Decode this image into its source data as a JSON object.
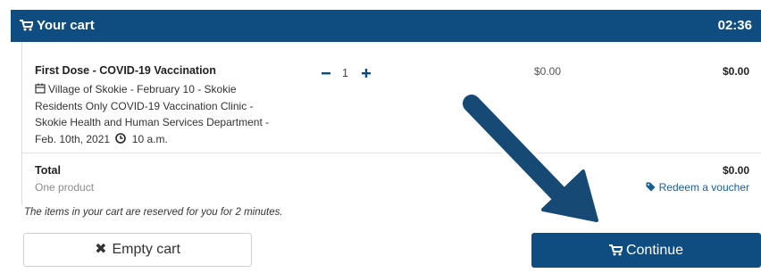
{
  "header": {
    "title": "Your cart",
    "timer": "02:36",
    "caret": "^",
    "background_color": "#0f4c7f"
  },
  "cart": {
    "items": [
      {
        "name": "First Dose - COVID-19 Vaccination",
        "description": "Village of Skokie - February 10 - Skokie Residents Only COVID-19 Vaccination Clinic - Skokie Health and Human Services Department - Feb. 10th, 2021",
        "time": "10 a.m.",
        "quantity": "1",
        "price": "$0.00",
        "line_total": "$0.00"
      }
    ],
    "total_label": "Total",
    "product_count": "One product",
    "grand_total": "$0.00",
    "voucher_link": "Redeem a voucher",
    "reserved_note": "The items in your cart are reserved for you for 2 minutes."
  },
  "buttons": {
    "empty_cart": "Empty cart",
    "continue": "Continue"
  },
  "icons": {
    "header": "cart-icon",
    "date": "calendar-icon",
    "time": "clock-icon",
    "voucher": "tag-icon",
    "empty": "close-icon",
    "continue": "cart-icon",
    "annotation": "arrow-pointer"
  },
  "colors": {
    "accent": "#0f4c7f",
    "link": "#1d5d94",
    "arrow": "#164a75"
  }
}
